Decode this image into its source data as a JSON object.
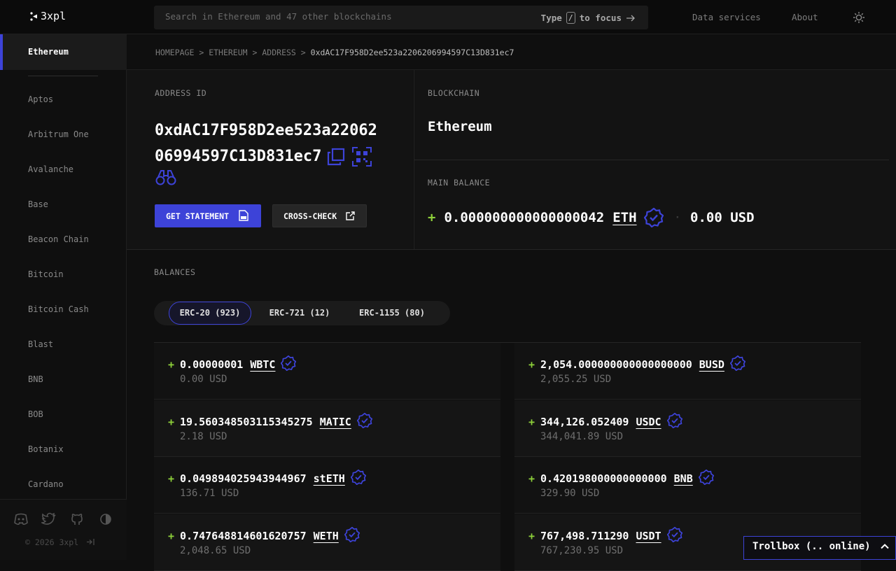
{
  "app": {
    "logo_text": "3xpl"
  },
  "search": {
    "placeholder": "Search in Ethereum and 47 other blockchains",
    "hint_prefix": "Type",
    "hint_key": "/",
    "hint_suffix": "to focus"
  },
  "nav": {
    "data_services": "Data services",
    "about": "About"
  },
  "sidebar": {
    "active": "Ethereum",
    "items": [
      "Aptos",
      "Arbitrum One",
      "Avalanche",
      "Base",
      "Beacon Chain",
      "Bitcoin",
      "Bitcoin Cash",
      "Blast",
      "BNB",
      "BOB",
      "Botanix",
      "Cardano"
    ],
    "copyright": "© 2026 3xpl"
  },
  "breadcrumb": {
    "home": "HOMEPAGE",
    "chain": "ETHEREUM",
    "section": "ADDRESS",
    "current": "0xdAC17F958D2ee523a2206206994597C13D831ec7"
  },
  "address": {
    "label": "ADDRESS ID",
    "line1": "0xdAC17F958D2ee523a22062",
    "line2": "06994597C13D831ec7",
    "statement_button": "GET STATEMENT",
    "crosscheck_button": "CROSS-CHECK"
  },
  "blockchain": {
    "label": "BLOCKCHAIN",
    "value": "Ethereum"
  },
  "main_balance": {
    "label": "MAIN BALANCE",
    "sign": "+",
    "amount": "0.000000000000000042",
    "ticker": "ETH",
    "usd": "0.00 USD"
  },
  "balances": {
    "label": "BALANCES",
    "tabs": [
      "ERC-20 (923)",
      "ERC-721 (12)",
      "ERC-1155 (80)"
    ],
    "tokens": [
      {
        "amount": "0.00000001",
        "ticker": "WBTC",
        "usd": "0.00 USD"
      },
      {
        "amount": "2,054.000000000000000000",
        "ticker": "BUSD",
        "usd": "2,055.25 USD"
      },
      {
        "amount": "19.560348503115345275",
        "ticker": "MATIC",
        "usd": "2.18 USD"
      },
      {
        "amount": "344,126.052409",
        "ticker": "USDC",
        "usd": "344,041.89 USD"
      },
      {
        "amount": "0.049894025943944967",
        "ticker": "stETH",
        "usd": "136.71 USD"
      },
      {
        "amount": "0.420198000000000000",
        "ticker": "BNB",
        "usd": "329.90 USD"
      },
      {
        "amount": "0.747648814601620757",
        "ticker": "WETH",
        "usd": "2,048.65 USD"
      },
      {
        "amount": "767,498.711290",
        "ticker": "USDT",
        "usd": "767,230.95 USD"
      }
    ]
  },
  "trollbox": {
    "label": "Trollbox (.. online)"
  },
  "colors": {
    "accent": "#3d43d8",
    "positive": "#8ed13a",
    "background": "#0f0f0f"
  },
  "icons": [
    "copy-icon",
    "qr-code-icon",
    "binoculars-icon",
    "pdf-icon",
    "external-link-icon",
    "verified-icon",
    "discord-icon",
    "twitter-icon",
    "github-icon",
    "contrast-icon",
    "logout-icon",
    "sun-icon",
    "arrow-right-icon",
    "chevron-up-icon"
  ]
}
